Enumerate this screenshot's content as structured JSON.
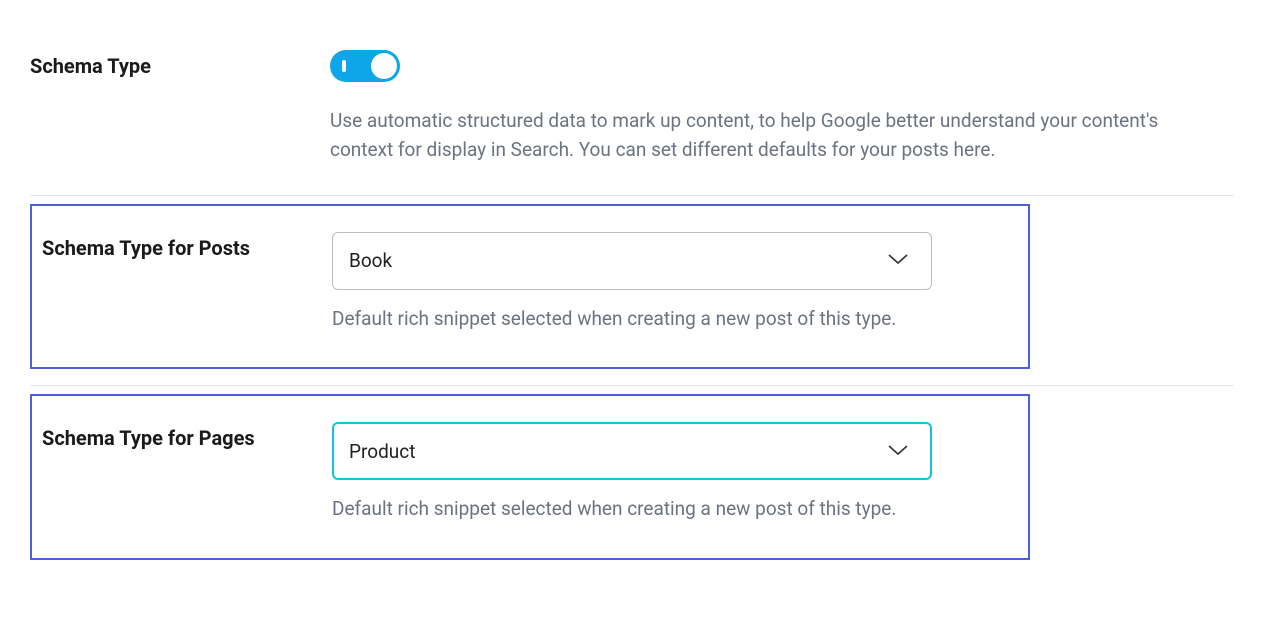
{
  "schema_type": {
    "label": "Schema Type",
    "toggle_on": true,
    "desc": "Use automatic structured data to mark up content, to help Google better understand your content's context for display in Search. You can set different defaults for your posts here."
  },
  "schema_posts": {
    "label": "Schema Type for Posts",
    "selected": "Book",
    "desc": "Default rich snippet selected when creating a new post of this type."
  },
  "schema_pages": {
    "label": "Schema Type for Pages",
    "selected": "Product",
    "desc": "Default rich snippet selected when creating a new post of this type."
  }
}
